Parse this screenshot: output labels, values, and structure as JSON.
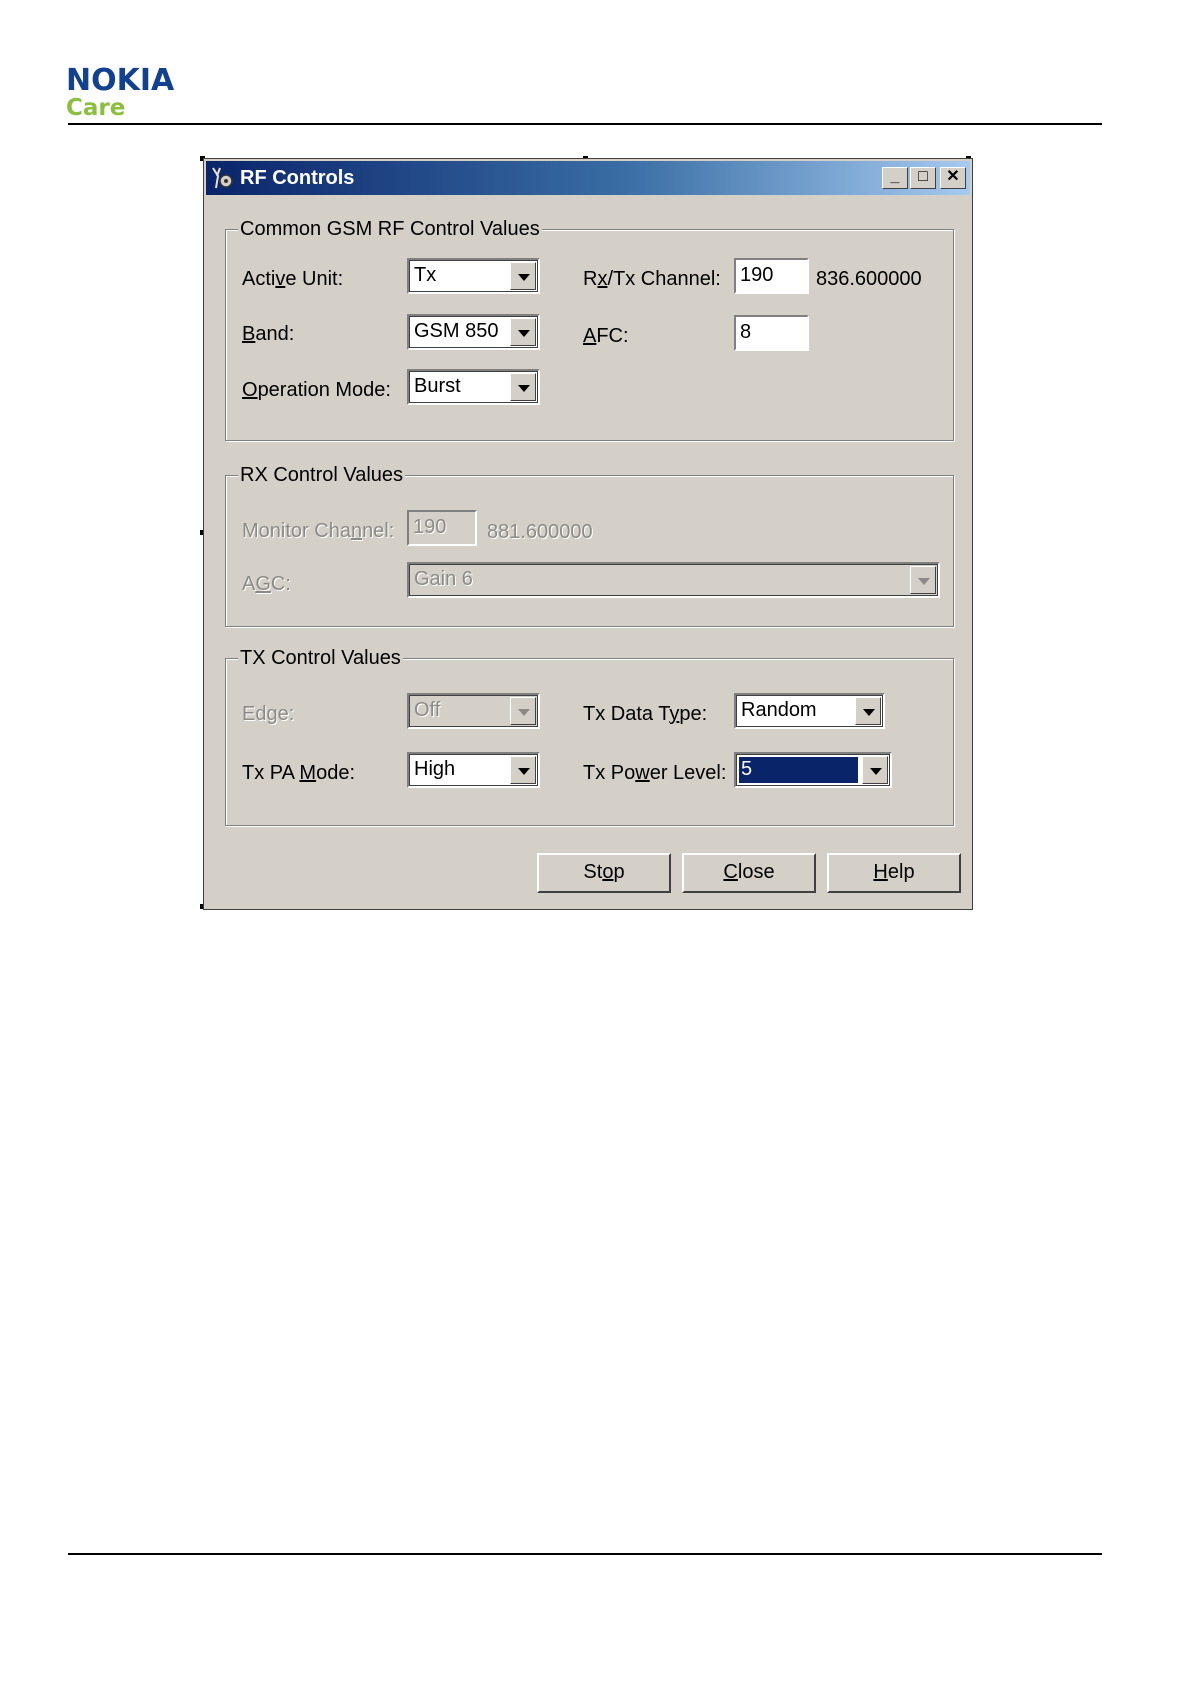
{
  "brand": {
    "name": "NOKIA",
    "sub": "Care"
  },
  "dialog": {
    "title": "RF Controls",
    "title_buttons": [
      "_",
      "□",
      "✕"
    ],
    "common": {
      "legend": "Common GSM RF Control Values",
      "active_unit": {
        "label_pre": "Acti",
        "label_u": "v",
        "label_post": "e Unit:",
        "value": "Tx"
      },
      "band": {
        "label_u": "B",
        "label_post": "and:",
        "value": "GSM 850"
      },
      "operation_mode": {
        "label_u": "O",
        "label_post": "peration Mode:",
        "value": "Burst"
      },
      "rxtx_channel": {
        "label_pre": "R",
        "label_u": "x",
        "label_post": "/Tx Channel:",
        "value": "190",
        "freq": "836.600000"
      },
      "afc": {
        "label_u": "A",
        "label_post": "FC:",
        "value": "8"
      }
    },
    "rx": {
      "legend": "RX Control Values",
      "monitor_channel": {
        "label_pre": "Monitor Cha",
        "label_u": "n",
        "label_post": "nel:",
        "value": "190",
        "freq": "881.600000"
      },
      "agc": {
        "label_pre": "A",
        "label_u": "G",
        "label_post": "C:",
        "value": "Gain 6"
      }
    },
    "tx": {
      "legend": "TX Control Values",
      "edge": {
        "label_pre": "Ed",
        "label_u": "g",
        "label_post": "e:",
        "value": "Off"
      },
      "tx_pa_mode": {
        "label_pre": "Tx PA ",
        "label_u": "M",
        "label_post": "ode:",
        "value": "High"
      },
      "tx_data_type": {
        "label_pre": "Tx Data T",
        "label_u": "y",
        "label_post": "pe:",
        "value": "Random"
      },
      "tx_power_level": {
        "label_pre": "Tx Po",
        "label_u": "w",
        "label_post": "er Level:",
        "value": "5"
      }
    },
    "buttons": {
      "stop": {
        "pre": "St",
        "u": "o",
        "post": "p"
      },
      "close": {
        "pre": "",
        "u": "C",
        "post": "lose"
      },
      "help": {
        "pre": "",
        "u": "H",
        "post": "elp"
      }
    }
  }
}
